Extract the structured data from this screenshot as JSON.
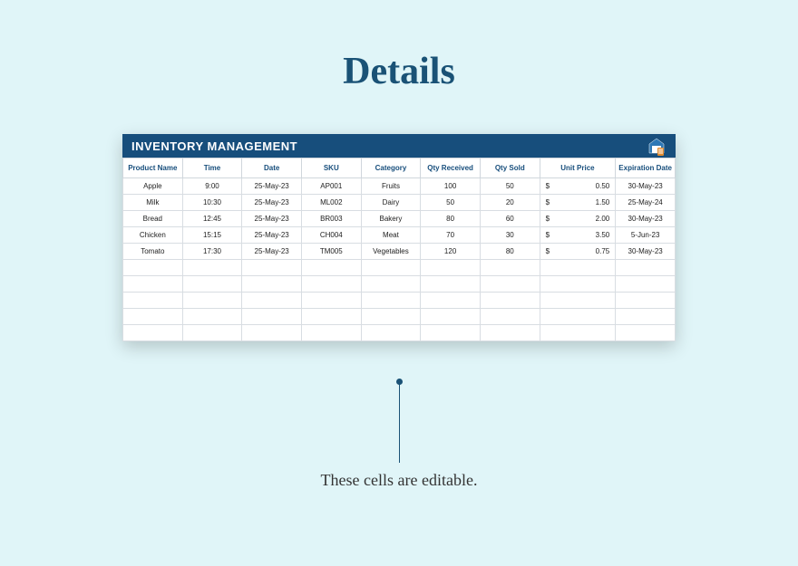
{
  "title": "Details",
  "sheet_title": "INVENTORY MANAGEMENT",
  "columns": [
    "Product Name",
    "Time",
    "Date",
    "SKU",
    "Category",
    "Qty Received",
    "Qty Sold",
    "Unit Price",
    "Expiration Date"
  ],
  "currency_symbol": "$",
  "rows": [
    {
      "product": "Apple",
      "time": "9:00",
      "date": "25-May-23",
      "sku": "AP001",
      "category": "Fruits",
      "qty_received": "100",
      "qty_sold": "50",
      "unit_price": "0.50",
      "expiration": "30-May-23"
    },
    {
      "product": "Milk",
      "time": "10:30",
      "date": "25-May-23",
      "sku": "ML002",
      "category": "Dairy",
      "qty_received": "50",
      "qty_sold": "20",
      "unit_price": "1.50",
      "expiration": "25-May-24"
    },
    {
      "product": "Bread",
      "time": "12:45",
      "date": "25-May-23",
      "sku": "BR003",
      "category": "Bakery",
      "qty_received": "80",
      "qty_sold": "60",
      "unit_price": "2.00",
      "expiration": "30-May-23"
    },
    {
      "product": "Chicken",
      "time": "15:15",
      "date": "25-May-23",
      "sku": "CH004",
      "category": "Meat",
      "qty_received": "70",
      "qty_sold": "30",
      "unit_price": "3.50",
      "expiration": "5-Jun-23"
    },
    {
      "product": "Tomato",
      "time": "17:30",
      "date": "25-May-23",
      "sku": "TM005",
      "category": "Vegetables",
      "qty_received": "120",
      "qty_sold": "80",
      "unit_price": "0.75",
      "expiration": "30-May-23"
    }
  ],
  "empty_rows": 5,
  "annotation": "These cells are editable."
}
